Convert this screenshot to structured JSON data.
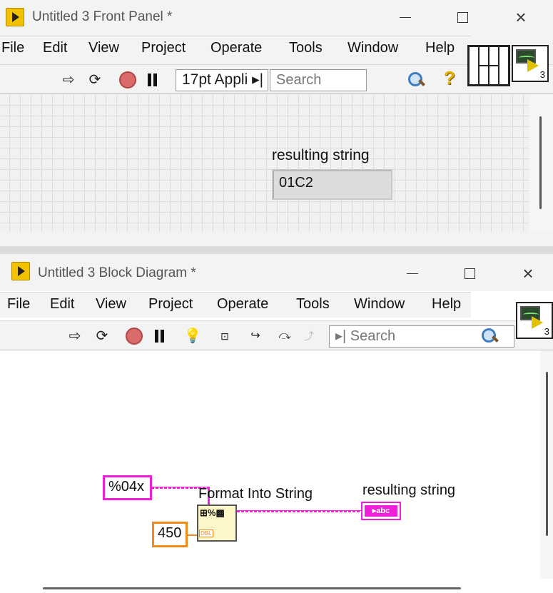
{
  "front_panel": {
    "title": "Untitled 3 Front Panel *",
    "menu": [
      "File",
      "Edit",
      "View",
      "Project",
      "Operate",
      "Tools",
      "Window",
      "Help"
    ],
    "font_ring": "17pt Appli",
    "search_placeholder": "Search",
    "icon_number": "3",
    "indicator": {
      "label": "resulting string",
      "value": "01C2"
    }
  },
  "block_diagram": {
    "title": "Untitled 3 Block Diagram *",
    "menu": [
      "File",
      "Edit",
      "View",
      "Project",
      "Operate",
      "Tools",
      "Window",
      "Help"
    ],
    "search_placeholder": "Search",
    "icon_number": "3",
    "format_constant": "%04x",
    "number_constant": "450",
    "node_label": "Format Into String",
    "node_glyph": "%",
    "node_type_tag": "DBL",
    "indicator_label": "resulting string",
    "indicator_terminal_text": "abc"
  },
  "colors": {
    "string_wire": "#f020d8",
    "numeric_wire": "#f08a1a",
    "labview_yellow": "#f2c200"
  }
}
